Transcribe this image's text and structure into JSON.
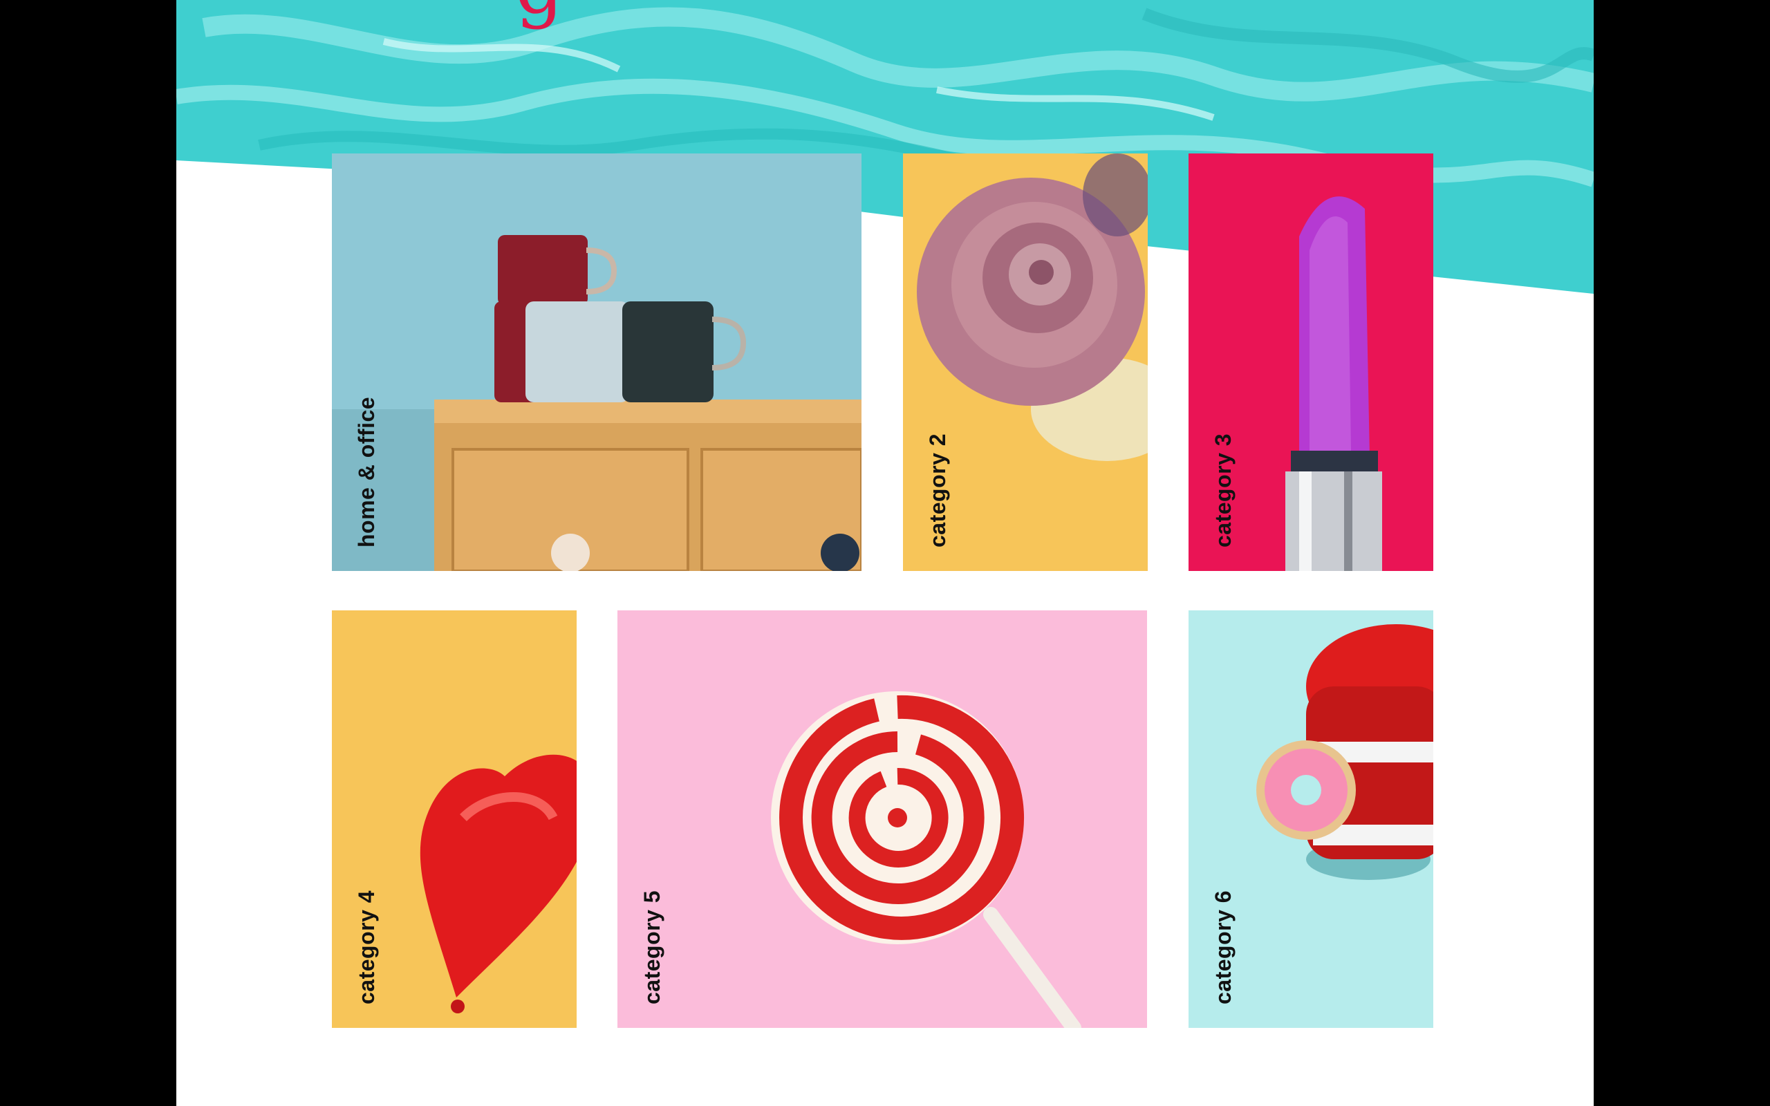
{
  "colors": {
    "page_bg": "#000000",
    "content_bg": "#ffffff",
    "paint_teal": "#3fcfcf",
    "tile_blue": "#8ec8d6",
    "tile_yellow": "#f7c559",
    "tile_crimson": "#ea1455",
    "tile_pink": "#fbbcda",
    "tile_mint": "#b6ecec"
  },
  "categories": [
    {
      "label": "home & office",
      "image": "mugs-on-drawer"
    },
    {
      "label": "category 2",
      "image": "rose"
    },
    {
      "label": "category 3",
      "image": "lipstick"
    },
    {
      "label": "category 4",
      "image": "heart-balloon"
    },
    {
      "label": "category 5",
      "image": "lollipop"
    },
    {
      "label": "category 6",
      "image": "chattering-teeth-donut"
    }
  ]
}
